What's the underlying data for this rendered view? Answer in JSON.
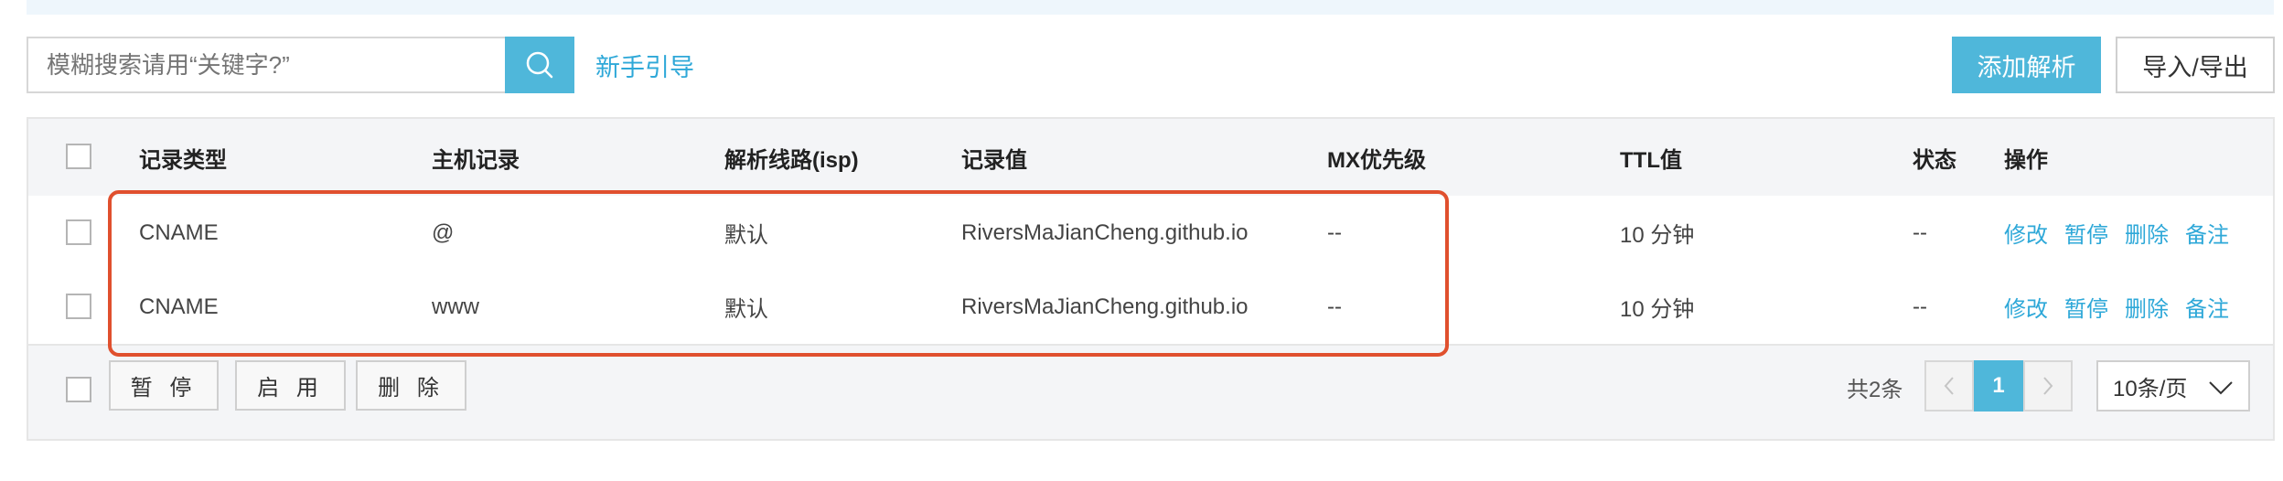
{
  "search": {
    "placeholder": "模糊搜索请用“关键字?”",
    "value": ""
  },
  "toolbar": {
    "guide_link": "新手引导",
    "add_button": "添加解析",
    "import_export_button": "导入/导出"
  },
  "table": {
    "headers": {
      "type": "记录类型",
      "host": "主机记录",
      "line": "解析线路(isp)",
      "value": "记录值",
      "mx": "MX优先级",
      "ttl": "TTL值",
      "status": "状态",
      "ops": "操作"
    },
    "rows": [
      {
        "type": "CNAME",
        "host": "@",
        "line": "默认",
        "value": "RiversMaJianCheng.github.io",
        "mx": "--",
        "ttl": "10 分钟",
        "status": "--"
      },
      {
        "type": "CNAME",
        "host": "www",
        "line": "默认",
        "value": "RiversMaJianCheng.github.io",
        "mx": "--",
        "ttl": "10 分钟",
        "status": "--"
      }
    ],
    "row_actions": {
      "edit": "修改",
      "pause": "暂停",
      "delete": "删除",
      "note": "备注"
    }
  },
  "footer": {
    "pause_button": "暂 停",
    "enable_button": "启 用",
    "delete_button": "删 除",
    "total": "共2条",
    "current_page": "1",
    "page_size": "10条/页"
  },
  "colors": {
    "accent": "#4fb7da",
    "link": "#2ea8d8",
    "annotation": "#e0502e"
  },
  "icons": {
    "search": "search-icon",
    "prev": "chevron-left-icon",
    "next": "chevron-right-icon",
    "dropdown": "chevron-down-icon"
  }
}
